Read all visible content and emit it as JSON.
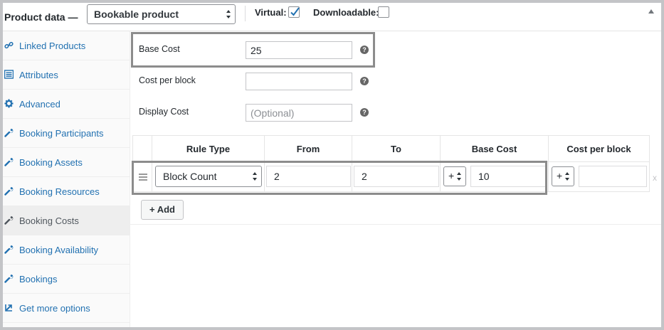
{
  "header": {
    "title": "Product data —",
    "product_type": "Bookable product",
    "virtual_label": "Virtual:",
    "virtual_checked": true,
    "downloadable_label": "Downloadable:",
    "downloadable_checked": false
  },
  "sidebar": {
    "items": [
      {
        "label": "Linked Products",
        "icon": "link-icon"
      },
      {
        "label": "Attributes",
        "icon": "list-icon"
      },
      {
        "label": "Advanced",
        "icon": "gear-icon"
      },
      {
        "label": "Booking Participants",
        "icon": "wrench-icon"
      },
      {
        "label": "Booking Assets",
        "icon": "wrench-icon"
      },
      {
        "label": "Booking Resources",
        "icon": "wrench-icon"
      },
      {
        "label": "Booking Costs",
        "icon": "wrench-icon",
        "active": true
      },
      {
        "label": "Booking Availability",
        "icon": "wrench-icon"
      },
      {
        "label": "Bookings",
        "icon": "wrench-icon"
      },
      {
        "label": "Get more options",
        "icon": "plugin-icon"
      }
    ]
  },
  "costs": {
    "base_cost_label": "Base Cost",
    "base_cost_value": "25",
    "cost_per_block_label": "Cost per block",
    "cost_per_block_value": "",
    "display_cost_label": "Display Cost",
    "display_cost_placeholder": "(Optional)",
    "help_glyph": "?"
  },
  "rules_table": {
    "columns": [
      "Rule Type",
      "From",
      "To",
      "Base Cost",
      "Cost per block"
    ],
    "rows": [
      {
        "rule_type": "Block Count",
        "from": "2",
        "to": "2",
        "base_cost_modifier": "+",
        "base_cost": "10",
        "block_cost_modifier": "+",
        "block_cost": "",
        "remove": "x"
      }
    ],
    "add_label": "+ Add"
  }
}
